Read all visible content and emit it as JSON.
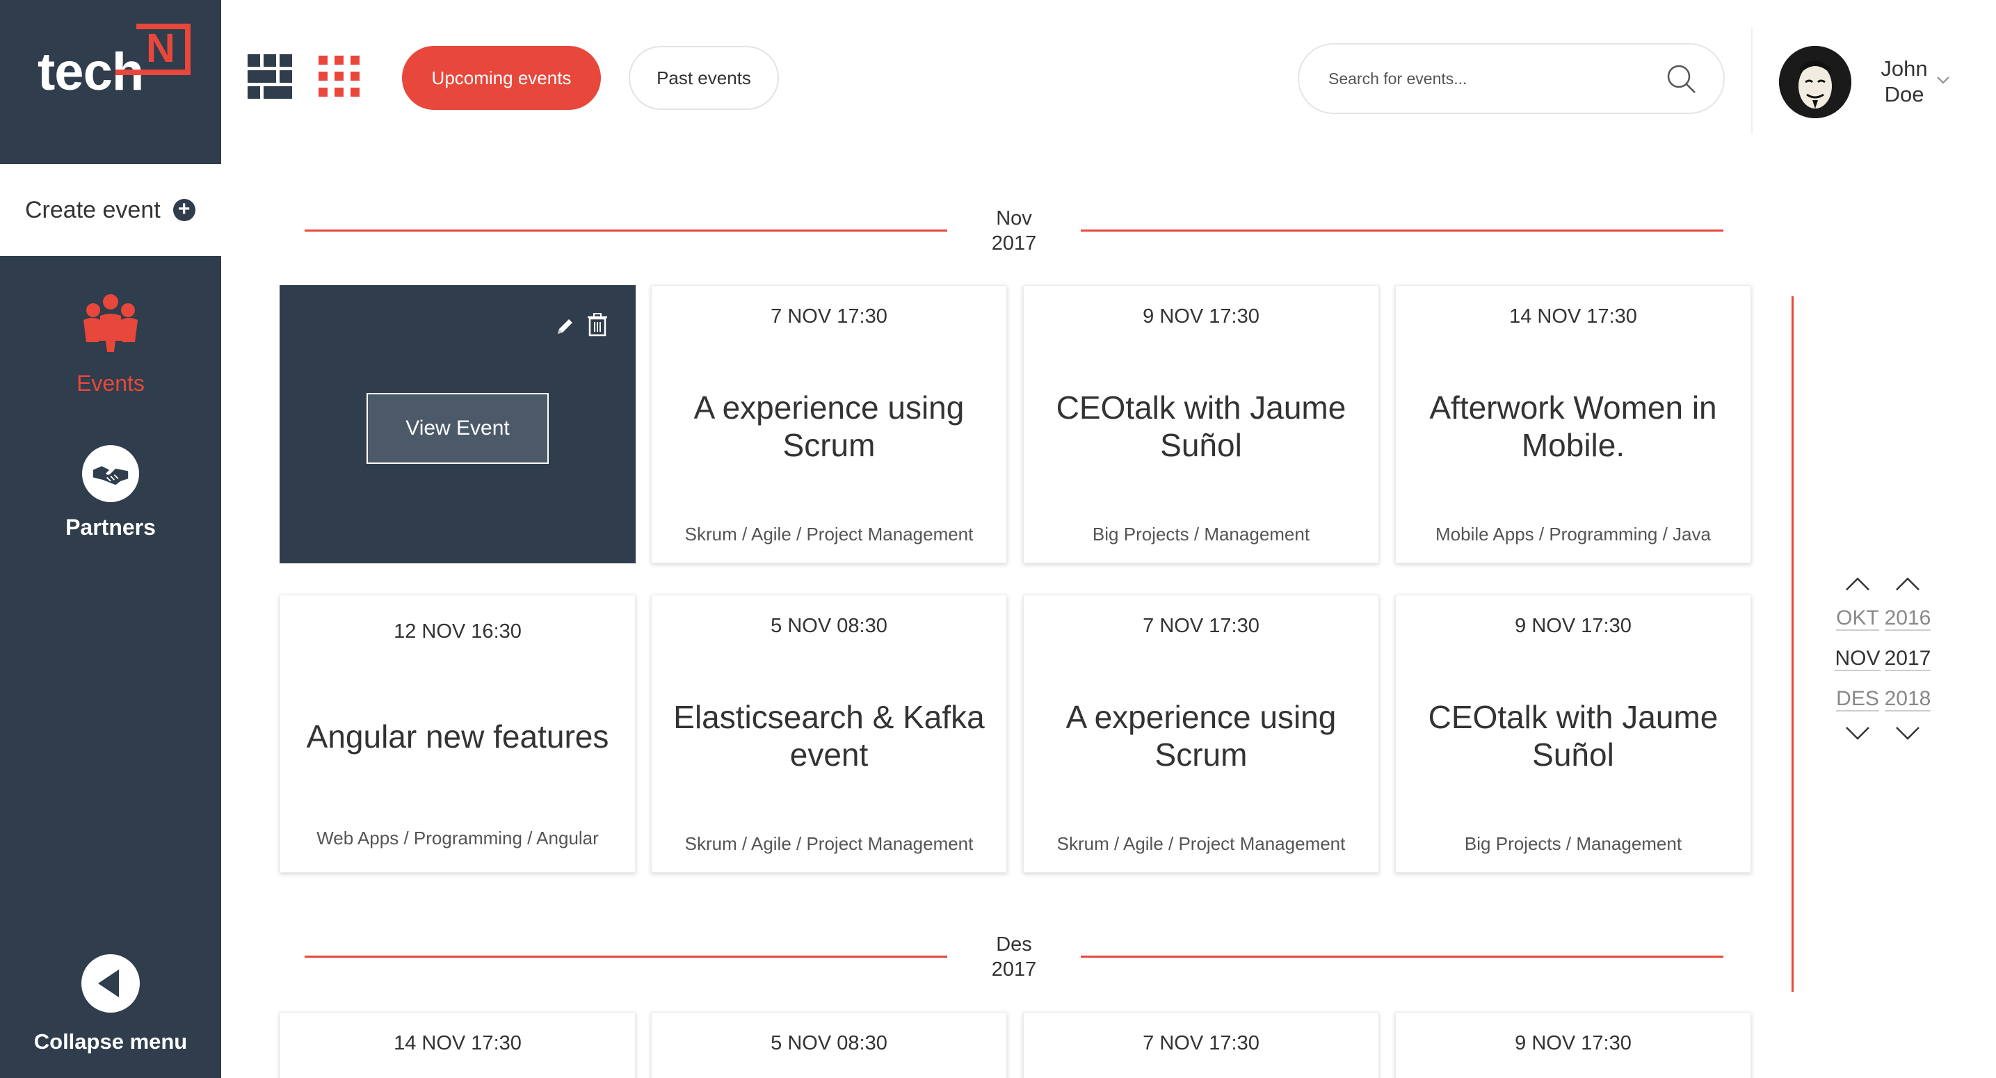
{
  "brand": {
    "logo_text": "tech",
    "logo_mark": "N",
    "accent": "#e8473b",
    "dark": "#2f3d4c"
  },
  "sidebar": {
    "create_event_label": "Create event",
    "items": [
      {
        "label": "Events",
        "icon": "people-icon",
        "active": true
      },
      {
        "label": "Partners",
        "icon": "handshake-icon",
        "active": false
      }
    ],
    "collapse_label": "Collapse menu"
  },
  "header": {
    "tabs": [
      {
        "label": "Upcoming events",
        "active": true
      },
      {
        "label": "Past events",
        "active": false
      }
    ],
    "search_placeholder": "Search for events...",
    "user_first": "John",
    "user_last": "Doe"
  },
  "months": [
    {
      "month": "Nov",
      "year": "2017"
    },
    {
      "month": "Des",
      "year": "2017"
    }
  ],
  "hovered_card": {
    "view_label": "View Event"
  },
  "cards_row1": [
    {
      "date": "7 NOV 17:30",
      "title": "A experience using Scrum",
      "tags": "Skrum / Agile / Project Management"
    },
    {
      "date": "9 NOV 17:30",
      "title": "CEOtalk with Jaume Suñol",
      "tags": "Big Projects / Management"
    },
    {
      "date": "14 NOV 17:30",
      "title": "Afterwork Women in Mobile.",
      "tags": "Mobile Apps / Programming / Java"
    }
  ],
  "cards_row2": [
    {
      "date": "12 NOV 16:30",
      "title": "Angular new features",
      "tags": "Web Apps / Programming / Angular"
    },
    {
      "date": "5 NOV 08:30",
      "title": "Elasticsearch & Kafka event",
      "tags": "Skrum / Agile / Project Management"
    },
    {
      "date": "7 NOV 17:30",
      "title": "A experience using Scrum",
      "tags": "Skrum / Agile / Project Management"
    },
    {
      "date": "9 NOV 17:30",
      "title": "CEOtalk with Jaume Suñol",
      "tags": "Big Projects / Management"
    }
  ],
  "cards_row3": [
    {
      "date": "14 NOV 17:30"
    },
    {
      "date": "5 NOV 08:30"
    },
    {
      "date": "7 NOV 17:30"
    },
    {
      "date": "9 NOV 17:30"
    }
  ],
  "timeline": {
    "months": [
      "OKT",
      "NOV",
      "DES"
    ],
    "years": [
      "2016",
      "2017",
      "2018"
    ],
    "active_month": "NOV",
    "active_year": "2017"
  }
}
